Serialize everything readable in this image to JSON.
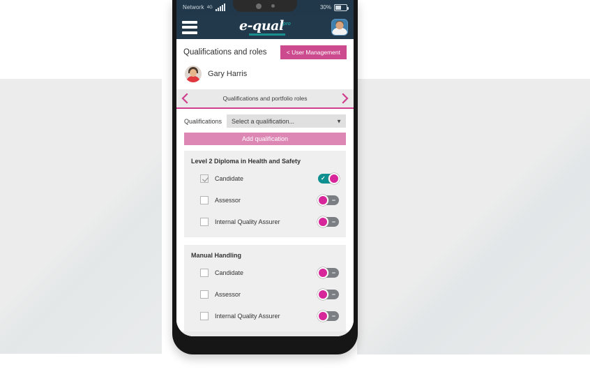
{
  "statusbar": {
    "network_label": "Network",
    "network_type": "4G",
    "battery_percent": "30%",
    "signal_icon": "signal-bars-icon",
    "battery_icon": "battery-icon"
  },
  "app_header": {
    "menu_icon": "hamburger-menu-icon",
    "logo_text": "e-qual",
    "logo_superscript": "pro",
    "profile_avatar": "profile-avatar-icon"
  },
  "page": {
    "title": "Qualifications and roles",
    "user_management_button": "< User Management",
    "user_name": "Gary Harris",
    "user_avatar": "user-avatar-icon"
  },
  "tabstrip": {
    "label": "Qualifications and portfolio roles",
    "prev_icon": "chevron-left-icon",
    "next_icon": "chevron-right-icon"
  },
  "form": {
    "select_label": "Qualifications",
    "select_value": "Select a qualification...",
    "select_caret_icon": "chevron-down-icon",
    "add_button": "Add qualification"
  },
  "qualifications": [
    {
      "title": "Level 2 Diploma in Health and Safety",
      "roles": [
        {
          "label": "Candidate",
          "checked": true,
          "toggle": "on",
          "toggle_mark": "✓"
        },
        {
          "label": "Assessor",
          "checked": false,
          "toggle": "off",
          "toggle_mark": "–"
        },
        {
          "label": "Internal Quality Assurer",
          "checked": false,
          "toggle": "off",
          "toggle_mark": "–"
        }
      ]
    },
    {
      "title": "Manual Handling",
      "roles": [
        {
          "label": "Candidate",
          "checked": false,
          "toggle": "off",
          "toggle_mark": "–"
        },
        {
          "label": "Assessor",
          "checked": false,
          "toggle": "off",
          "toggle_mark": "–"
        },
        {
          "label": "Internal Quality Assurer",
          "checked": false,
          "toggle": "off",
          "toggle_mark": "–"
        }
      ]
    }
  ],
  "colors": {
    "header_navy": "#22394b",
    "accent_pink": "#cf3f8e",
    "button_pink": "#cc4a8e",
    "add_button_pink": "#dd87b5",
    "toggle_on_teal": "#0f9090",
    "toggle_knob_pink": "#d6269a",
    "panel_gray": "#e9e9e9",
    "card_gray": "#efefef"
  }
}
